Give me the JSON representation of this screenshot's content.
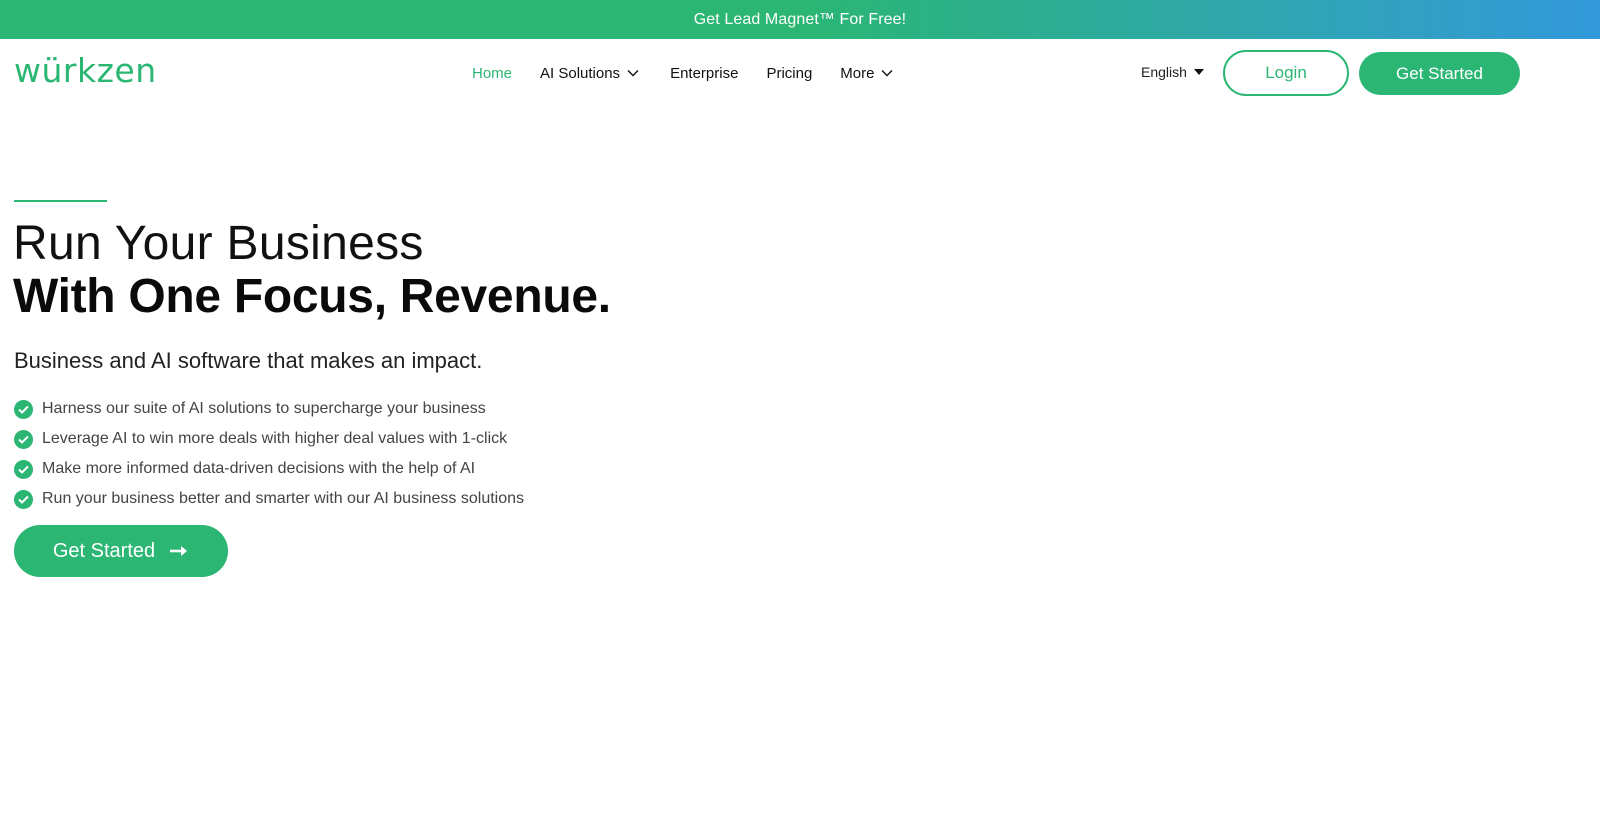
{
  "promo": {
    "text": "Get Lead Magnet™ For Free!"
  },
  "header": {
    "logo": "würkzen",
    "nav": [
      {
        "label": "Home",
        "active": true
      },
      {
        "label": "AI Solutions",
        "dropdown": true
      },
      {
        "label": "Enterprise"
      },
      {
        "label": "Pricing"
      },
      {
        "label": "More",
        "dropdown": true
      }
    ],
    "language": "English",
    "login_label": "Login",
    "get_started_label": "Get Started"
  },
  "hero": {
    "title_line1": "Run Your Business",
    "title_line2": "With One Focus, Revenue.",
    "subtitle": "Business and AI software that makes an impact.",
    "benefits": [
      "Harness our suite of AI solutions to supercharge your business",
      "Leverage AI to win more deals with higher deal values with 1-click",
      "Make more informed data-driven decisions with the help of AI",
      "Run your business better and smarter with our AI business solutions"
    ],
    "cta_label": "Get Started"
  },
  "colors": {
    "brand": "#2bb673",
    "promo_gradient_end": "#3399db",
    "text": "#111111"
  },
  "icons": {
    "benefit": "check-circle-icon",
    "cta": "arrow-right-icon",
    "nav_dropdown": "chevron-down-icon",
    "language": "caret-down-icon"
  }
}
